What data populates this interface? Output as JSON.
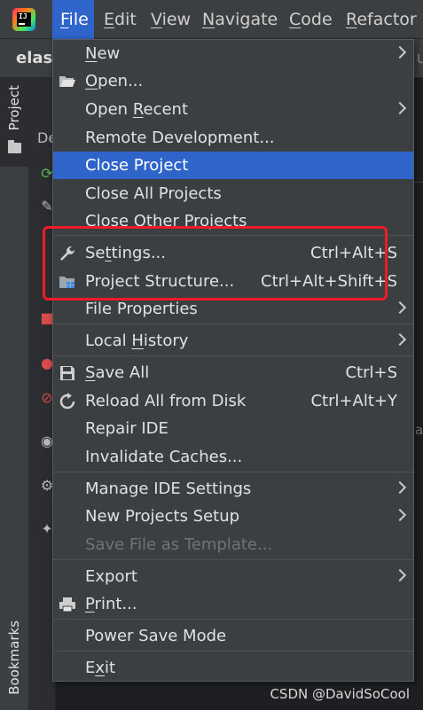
{
  "menubar": {
    "items": [
      {
        "pre": "",
        "ul": "F",
        "post": "ile"
      },
      {
        "pre": "",
        "ul": "E",
        "post": "dit"
      },
      {
        "pre": "",
        "ul": "V",
        "post": "iew"
      },
      {
        "pre": "",
        "ul": "N",
        "post": "avigate"
      },
      {
        "pre": "",
        "ul": "C",
        "post": "ode"
      },
      {
        "pre": "",
        "ul": "R",
        "post": "efactor"
      }
    ]
  },
  "project": {
    "name": "elast",
    "edge_char": "u"
  },
  "left_strip": {
    "project_tab": "Project",
    "bookmarks_tab": "Bookmarks"
  },
  "side_panel": {
    "label": "De"
  },
  "file_menu": {
    "items": [
      {
        "pre": "",
        "ul": "N",
        "post": "ew",
        "shortcut": "",
        "submenu": true,
        "icon": ""
      },
      {
        "pre": "",
        "ul": "O",
        "post": "pen...",
        "shortcut": "",
        "submenu": false,
        "icon": "folder-open-icon"
      },
      {
        "pre": "Open ",
        "ul": "R",
        "post": "ecent",
        "shortcut": "",
        "submenu": true,
        "icon": ""
      },
      {
        "pre": "Remote Development...",
        "ul": "",
        "post": "",
        "shortcut": "",
        "submenu": false,
        "icon": ""
      },
      {
        "pre": "Close Project",
        "ul": "",
        "post": "",
        "shortcut": "",
        "submenu": false,
        "icon": "",
        "selected": true
      },
      {
        "pre": "Close All Projects",
        "ul": "",
        "post": "",
        "shortcut": "",
        "submenu": false,
        "icon": ""
      },
      {
        "pre": "Close Other Projects",
        "ul": "",
        "post": "",
        "shortcut": "",
        "submenu": false,
        "icon": ""
      },
      {
        "pre": "Se",
        "ul": "t",
        "post": "tings...",
        "shortcut": "Ctrl+Alt+S",
        "submenu": false,
        "icon": "wrench-icon"
      },
      {
        "pre": "Project Structure...",
        "ul": "",
        "post": "",
        "shortcut": "Ctrl+Alt+Shift+S",
        "submenu": false,
        "icon": "project-structure-icon"
      },
      {
        "pre": "File Properties",
        "ul": "",
        "post": "",
        "shortcut": "",
        "submenu": true,
        "icon": ""
      },
      {
        "pre": "Local ",
        "ul": "H",
        "post": "istory",
        "shortcut": "",
        "submenu": true,
        "icon": ""
      },
      {
        "pre": "",
        "ul": "S",
        "post": "ave All",
        "shortcut": "Ctrl+S",
        "submenu": false,
        "icon": "save-icon"
      },
      {
        "pre": "Reload All from Disk",
        "ul": "",
        "post": "",
        "shortcut": "Ctrl+Alt+Y",
        "submenu": false,
        "icon": "reload-icon"
      },
      {
        "pre": "Repair IDE",
        "ul": "",
        "post": "",
        "shortcut": "",
        "submenu": false,
        "icon": ""
      },
      {
        "pre": "Invalidate Caches...",
        "ul": "",
        "post": "",
        "shortcut": "",
        "submenu": false,
        "icon": ""
      },
      {
        "pre": "Manage IDE Settings",
        "ul": "",
        "post": "",
        "shortcut": "",
        "submenu": true,
        "icon": ""
      },
      {
        "pre": "New Projects Setup",
        "ul": "",
        "post": "",
        "shortcut": "",
        "submenu": true,
        "icon": ""
      },
      {
        "pre": "Save File as Template...",
        "ul": "",
        "post": "",
        "shortcut": "",
        "submenu": false,
        "icon": "",
        "disabled": true
      },
      {
        "pre": "Export",
        "ul": "",
        "post": "",
        "shortcut": "",
        "submenu": true,
        "icon": ""
      },
      {
        "pre": "",
        "ul": "P",
        "post": "rint...",
        "shortcut": "",
        "submenu": false,
        "icon": "printer-icon"
      },
      {
        "pre": "Power Save Mode",
        "ul": "",
        "post": "",
        "shortcut": "",
        "submenu": false,
        "icon": ""
      },
      {
        "pre": "E",
        "ul": "x",
        "post": "it",
        "shortcut": "",
        "submenu": false,
        "icon": ""
      }
    ]
  },
  "watermark": "CSDN @DavidSoCool",
  "colors": {
    "accent": "#2f65ca",
    "highlight_box": "#ee1c25",
    "menu_bg": "#3c3f41"
  }
}
